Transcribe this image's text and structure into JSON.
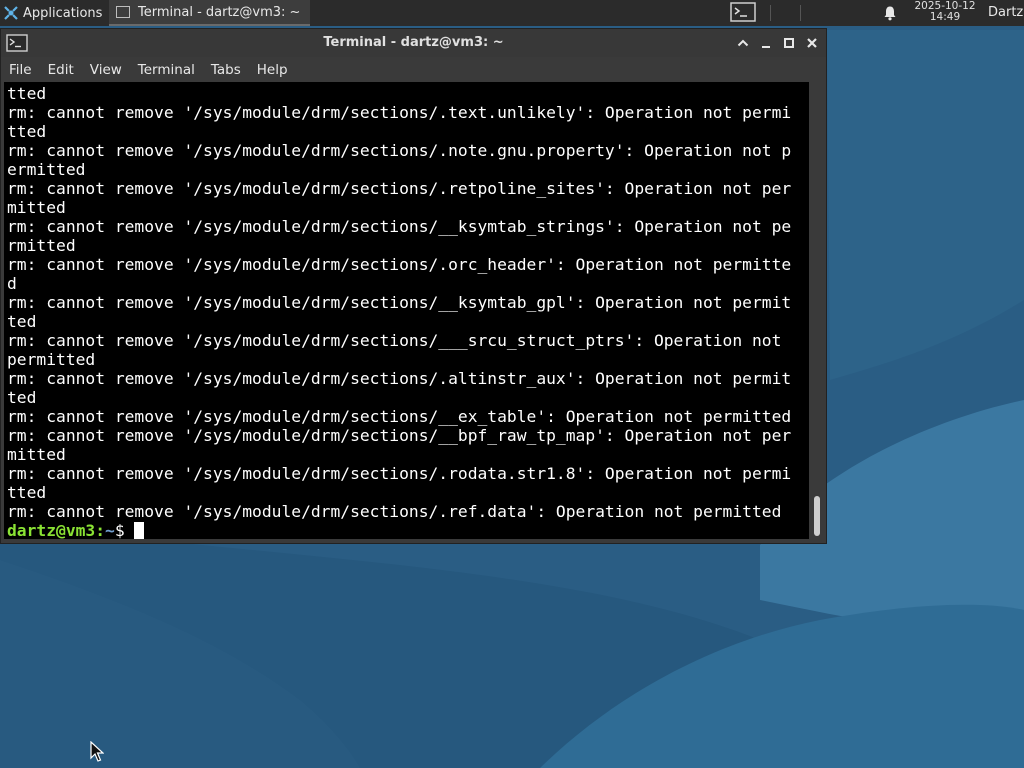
{
  "panel": {
    "apps_label": "Applications",
    "task_label": "Terminal - dartz@vm3: ~",
    "clock_date": "2025-10-12",
    "clock_time": "14:49",
    "user": "Dartz"
  },
  "window": {
    "title": "Terminal - dartz@vm3: ~",
    "menu": [
      "File",
      "Edit",
      "View",
      "Terminal",
      "Tabs",
      "Help"
    ]
  },
  "terminal": {
    "lines": [
      "tted",
      "rm: cannot remove '/sys/module/drm/sections/.text.unlikely': Operation not permi",
      "tted",
      "rm: cannot remove '/sys/module/drm/sections/.note.gnu.property': Operation not p",
      "ermitted",
      "rm: cannot remove '/sys/module/drm/sections/.retpoline_sites': Operation not per",
      "mitted",
      "rm: cannot remove '/sys/module/drm/sections/__ksymtab_strings': Operation not pe",
      "rmitted",
      "rm: cannot remove '/sys/module/drm/sections/.orc_header': Operation not permitte",
      "d",
      "rm: cannot remove '/sys/module/drm/sections/__ksymtab_gpl': Operation not permit",
      "ted",
      "rm: cannot remove '/sys/module/drm/sections/___srcu_struct_ptrs': Operation not ",
      "permitted",
      "rm: cannot remove '/sys/module/drm/sections/.altinstr_aux': Operation not permit",
      "ted",
      "rm: cannot remove '/sys/module/drm/sections/__ex_table': Operation not permitted",
      "rm: cannot remove '/sys/module/drm/sections/__bpf_raw_tp_map': Operation not per",
      "mitted",
      "rm: cannot remove '/sys/module/drm/sections/.rodata.str1.8': Operation not permi",
      "tted",
      "rm: cannot remove '/sys/module/drm/sections/.ref.data': Operation not permitted"
    ],
    "prompt_user": "dartz@vm3",
    "prompt_sep": ":",
    "prompt_path": "~",
    "prompt_symbol": "$ "
  },
  "icons": {
    "apps": "xfce-apps-icon",
    "task": "terminal-icon",
    "panel_launcher": "terminal-launcher-icon",
    "notifications": "bell-icon",
    "window_controls": [
      "chevron-up-icon",
      "minimize-icon",
      "maximize-icon",
      "close-icon"
    ]
  },
  "colors": {
    "prompt_user": "#8ae234",
    "prompt_path": "#729fcf",
    "terminal_bg": "#000000",
    "panel_bg": "#2b2b2b"
  }
}
